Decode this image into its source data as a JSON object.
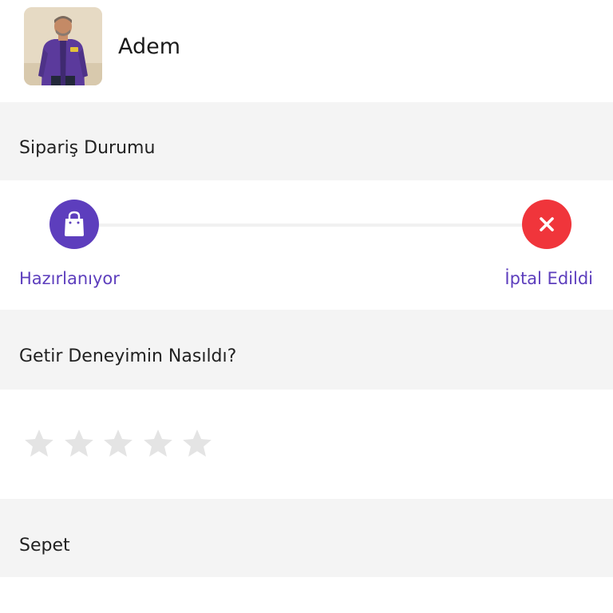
{
  "courier": {
    "name": "Adem",
    "avatar_icon": "courier-photo"
  },
  "order_status": {
    "title": "Sipariş Durumu",
    "steps": [
      {
        "label": "Hazırlanıyor",
        "icon": "shopping-bag-icon",
        "color": "#5d3ebd"
      },
      {
        "label": "İptal Edildi",
        "icon": "close-icon",
        "color": "#f0353b"
      }
    ],
    "label_color": "#5d3ebd"
  },
  "rating": {
    "title": "Getir Deneyimin Nasıldı?",
    "value": 0,
    "max": 5,
    "star_color_empty": "#e4e4e4"
  },
  "cart": {
    "title": "Sepet"
  }
}
